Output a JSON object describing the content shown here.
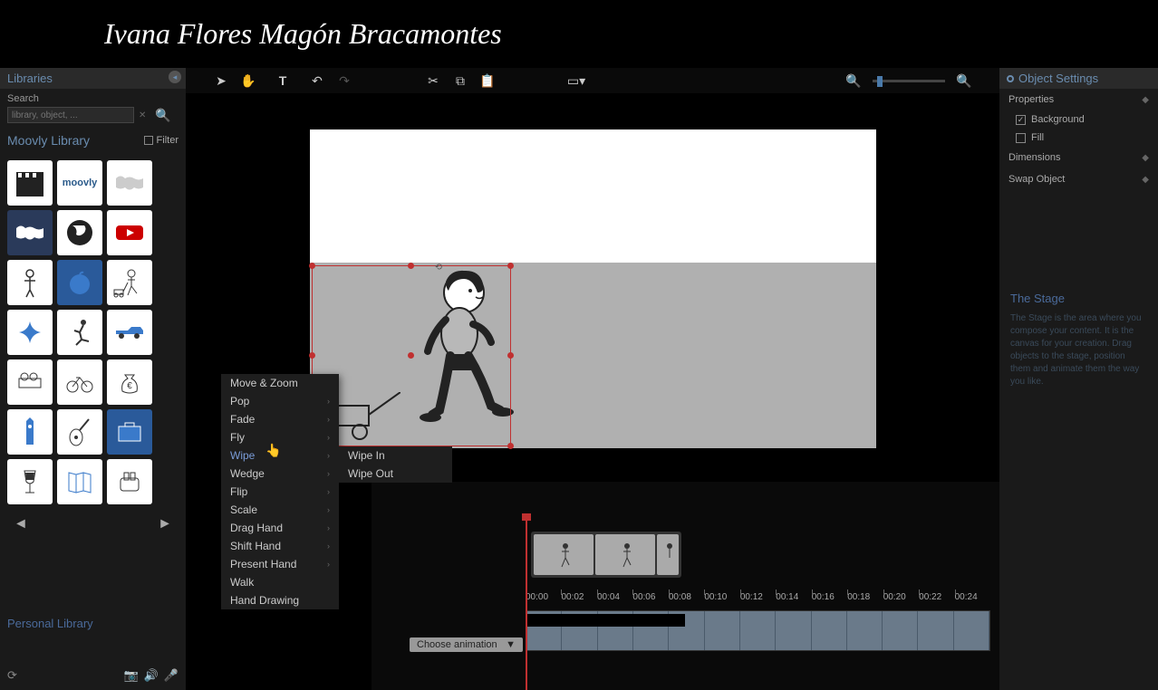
{
  "header": {
    "title": "Ivana Flores Magón Bracamontes"
  },
  "sidebar": {
    "libraries_label": "Libraries",
    "search_label": "Search",
    "search_placeholder": "library, object, ...",
    "moovly_library": "Moovly Library",
    "filter_label": "Filter",
    "personal_library": "Personal Library",
    "items": [
      {
        "id": "clapper"
      },
      {
        "id": "moovly"
      },
      {
        "id": "worldmap-light"
      },
      {
        "id": "worldmap-dark"
      },
      {
        "id": "globe"
      },
      {
        "id": "youtube"
      },
      {
        "id": "man-standing"
      },
      {
        "id": "apple"
      },
      {
        "id": "boy-wagon"
      },
      {
        "id": "star-blue"
      },
      {
        "id": "runner"
      },
      {
        "id": "pickup"
      },
      {
        "id": "projector"
      },
      {
        "id": "bicycle"
      },
      {
        "id": "moneybag"
      },
      {
        "id": "bigben"
      },
      {
        "id": "guitar"
      },
      {
        "id": "briefcase"
      },
      {
        "id": "wineglass"
      },
      {
        "id": "brochure"
      },
      {
        "id": "toaster"
      }
    ]
  },
  "context_menu": {
    "items": [
      {
        "label": "Move & Zoom",
        "arrow": false
      },
      {
        "label": "Pop",
        "arrow": true
      },
      {
        "label": "Fade",
        "arrow": true
      },
      {
        "label": "Fly",
        "arrow": true
      },
      {
        "label": "Wipe",
        "arrow": true,
        "hover": true
      },
      {
        "label": "Wedge",
        "arrow": true
      },
      {
        "label": "Flip",
        "arrow": true
      },
      {
        "label": "Scale",
        "arrow": true
      },
      {
        "label": "Drag Hand",
        "arrow": true
      },
      {
        "label": "Shift Hand",
        "arrow": true
      },
      {
        "label": "Present Hand",
        "arrow": true
      },
      {
        "label": "Walk",
        "arrow": false
      },
      {
        "label": "Hand Drawing",
        "arrow": false
      }
    ],
    "submenu": [
      {
        "label": "Wipe In"
      },
      {
        "label": "Wipe Out"
      }
    ]
  },
  "timeline": {
    "ticks": [
      "00:00",
      "00:02",
      "00:04",
      "00:06",
      "00:08",
      "00:10",
      "00:12",
      "00:14",
      "00:16",
      "00:18",
      "00:20",
      "00:22",
      "00:24"
    ],
    "choose_animation": "Choose animation"
  },
  "right": {
    "object_settings": "Object Settings",
    "properties": "Properties",
    "background": "Background",
    "fill": "Fill",
    "dimensions": "Dimensions",
    "swap_object": "Swap Object",
    "help_title": "The Stage",
    "help_text": "The Stage is the area where you compose your content. It is the canvas for your creation. Drag objects to the stage, position them and animate them the way you like."
  }
}
